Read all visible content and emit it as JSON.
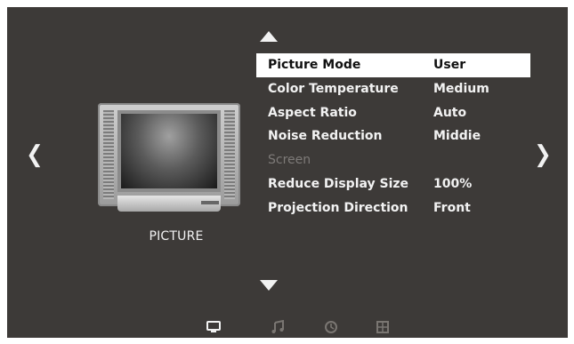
{
  "navigation": {
    "left_arrow": "❮",
    "right_arrow": "❯"
  },
  "tv_illustration": {
    "label": "PICTURE"
  },
  "menu": {
    "items": [
      {
        "label": "Picture Mode",
        "value": "User",
        "selected": true
      },
      {
        "label": "Color Temperature",
        "value": "Medium"
      },
      {
        "label": "Aspect Ratio",
        "value": "Auto"
      },
      {
        "label": "Noise Reduction",
        "value": "Middie"
      },
      {
        "label": "Screen",
        "value": "",
        "disabled": true
      },
      {
        "label": "Reduce Display Size",
        "value": "100%"
      },
      {
        "label": "Projection Direction",
        "value": "Front"
      }
    ]
  },
  "bottom_icons": [
    {
      "name": "picture-icon",
      "active": true
    },
    {
      "name": "music-icon",
      "active": false
    },
    {
      "name": "clock-icon",
      "active": false
    },
    {
      "name": "grid-icon",
      "active": false
    }
  ],
  "colors": {
    "background": "#3d3a38",
    "text": "#f2f2f2",
    "selected_bg": "#ffffff",
    "disabled_text": "#7d7a78",
    "inactive_icon": "#7a7672"
  }
}
